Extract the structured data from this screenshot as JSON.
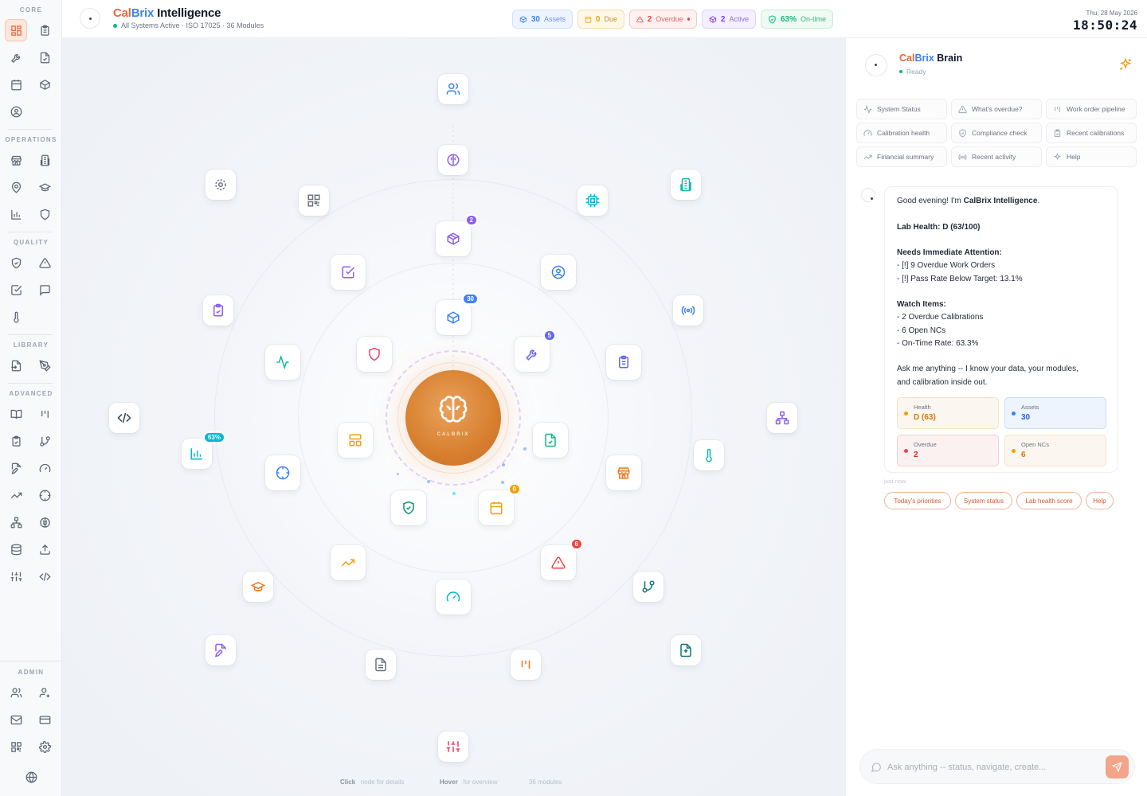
{
  "sidebar": {
    "sections": {
      "core": "CORE",
      "operations": "OPERATIONS",
      "quality": "QUALITY",
      "library": "LIBRARY",
      "advanced": "ADVANCED",
      "admin": "ADMIN"
    }
  },
  "header": {
    "brand_cal": "Cal",
    "brand_brix": "Brix",
    "brand_rest": "Intelligence",
    "status": "All Systems Active · ISO 17025 · 36 Modules",
    "chips": {
      "assets": {
        "count": "30",
        "label": "Assets"
      },
      "due": {
        "count": "0",
        "label": "Due"
      },
      "overdue": {
        "count": "2",
        "label": "Overdue"
      },
      "active": {
        "count": "2",
        "label": "Active"
      },
      "ontime": {
        "count": "63%",
        "label": "On-time"
      }
    },
    "date": "Thu, 28 May 2026",
    "time": "18:50:24"
  },
  "graph": {
    "core_label": "CALBRIX",
    "badges": {
      "assets": "30",
      "inventory": "2",
      "maintenance": "5",
      "due": "0",
      "overdue": "6",
      "ontime": "63%"
    },
    "hint": {
      "click": "Click",
      "click_text": "node for details",
      "hover": "Hover",
      "hover_text": "for overview",
      "modules": "36 modules"
    }
  },
  "panel": {
    "title_cal": "Cal",
    "title_brix": "Brix",
    "title_rest": "Brain",
    "status": "Ready",
    "quick_actions": [
      "System Status",
      "What's overdue?",
      "Work order pipeline",
      "Calibration health",
      "Compliance check",
      "Recent calibrations",
      "Financial summary",
      "Recent activity",
      "Help"
    ],
    "message": {
      "greeting_pre": "Good evening! I'm ",
      "greeting_name": "CalBrix Intelligence",
      "greeting_post": ".",
      "health": "Lab Health: D (63/100)",
      "attention_title": "Needs Immediate Attention:",
      "attention": [
        "- [!] 9 Overdue Work Orders",
        "- [!] Pass Rate Below Target: 13.1%"
      ],
      "watch_title": "Watch Items:",
      "watch": [
        "- 2 Overdue Calibrations",
        "- 6 Open NCs",
        "- On-Time Rate: 63.3%"
      ],
      "closing_1": "Ask me anything -- I know your data, your modules,",
      "closing_2": "and calibration inside out.",
      "stats": [
        {
          "label": "Health",
          "value": "D (63)",
          "color": "#f59e0b"
        },
        {
          "label": "Assets",
          "value": "30",
          "color": "#3b82f6"
        },
        {
          "label": "Overdue",
          "value": "2",
          "color": "#ef4444"
        },
        {
          "label": "Open NCs",
          "value": "6",
          "color": "#f59e0b"
        }
      ],
      "time": "just now"
    },
    "suggestions": [
      "Today's priorities",
      "System status",
      "Lab health score",
      "Help"
    ],
    "input_placeholder": "Ask anything -- status, navigate, create..."
  }
}
